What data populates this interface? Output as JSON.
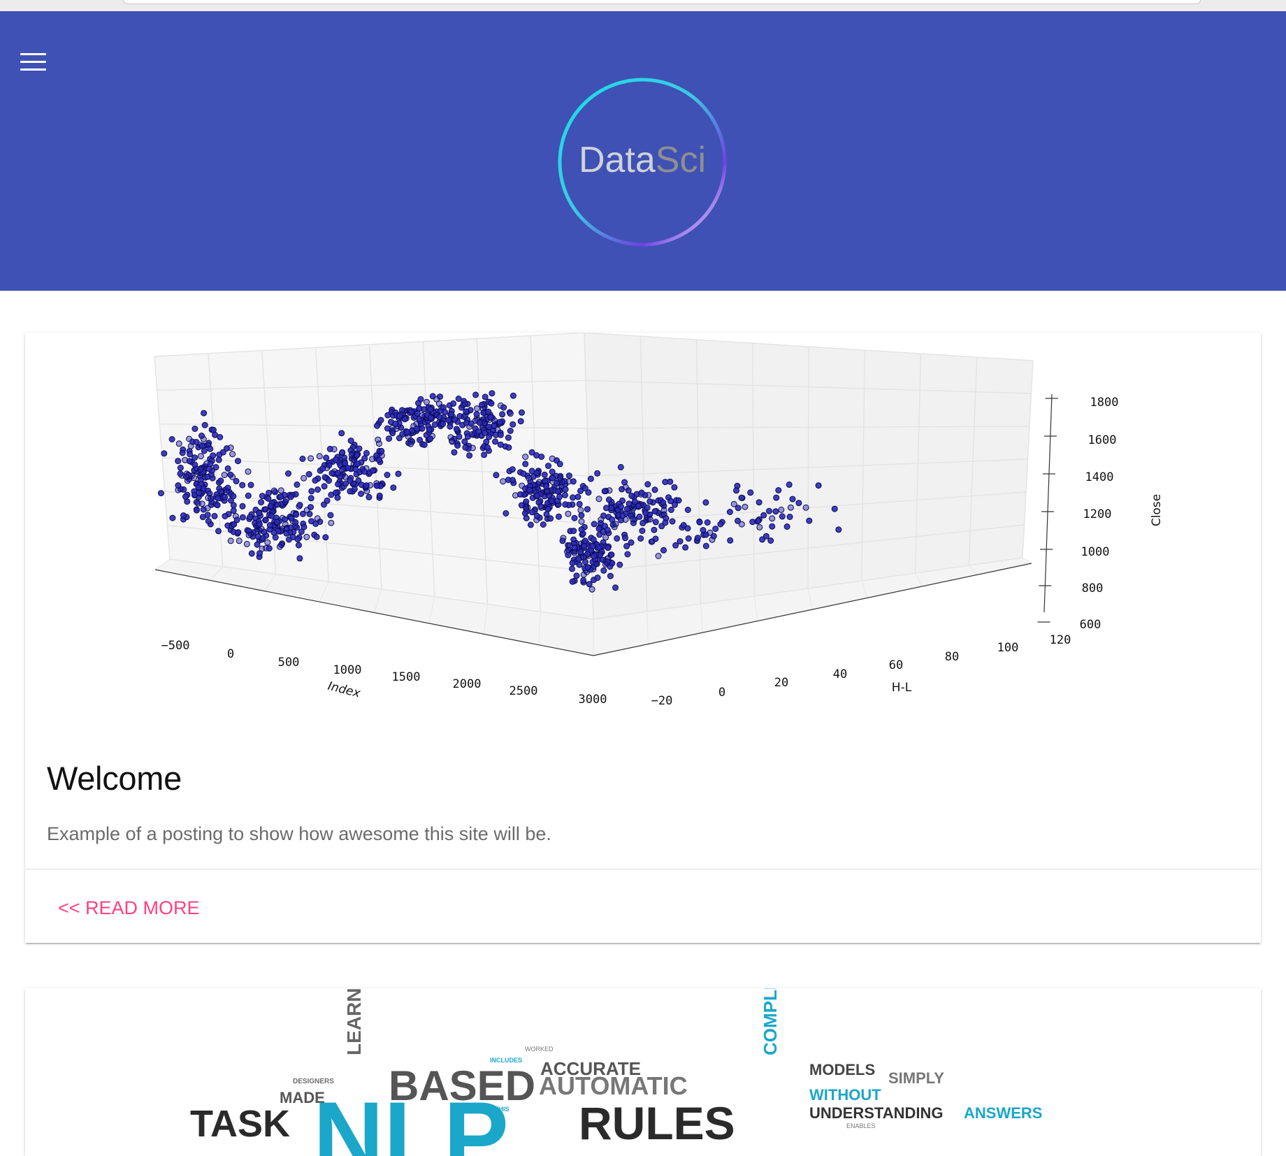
{
  "header": {
    "logo_text_1": "Data",
    "logo_text_2": "Sci",
    "menu_icon": "hamburger-menu-icon"
  },
  "posts": [
    {
      "title": "Welcome",
      "summary": "Example of a posting to show how awesome this site will be.",
      "read_more": "<< READ MORE"
    }
  ],
  "chart_data": {
    "type": "scatter",
    "projection": "3d",
    "xlabel": "Index",
    "ylabel": "H-L",
    "zlabel": "Close",
    "x_ticks": [
      "−500",
      "0",
      "500",
      "1000",
      "1500",
      "2000",
      "2500",
      "3000"
    ],
    "y_ticks": [
      "−20",
      "0",
      "20",
      "40",
      "60",
      "80",
      "100",
      "120"
    ],
    "z_ticks": [
      "600",
      "800",
      "1000",
      "1200",
      "1400",
      "1600",
      "1800"
    ],
    "xlim": [
      -500,
      3000
    ],
    "ylim": [
      -20,
      120
    ],
    "zlim": [
      600,
      1800
    ],
    "marker_color": "#2a2ab8",
    "grid": true
  },
  "word_cloud": {
    "words": [
      "DESIGNERS",
      "MADE",
      "TASK",
      "LEARNING",
      "INCLUDES",
      "BASED",
      "THIS",
      "WORKED",
      "ACCURATE",
      "AUTOMATIC",
      "RULES",
      "COMPLEXITY",
      "MODELS",
      "SIMPLY",
      "WITHOUT",
      "UNDERSTANDING",
      "ENABLES",
      "ANSWERS",
      "NLP"
    ]
  }
}
